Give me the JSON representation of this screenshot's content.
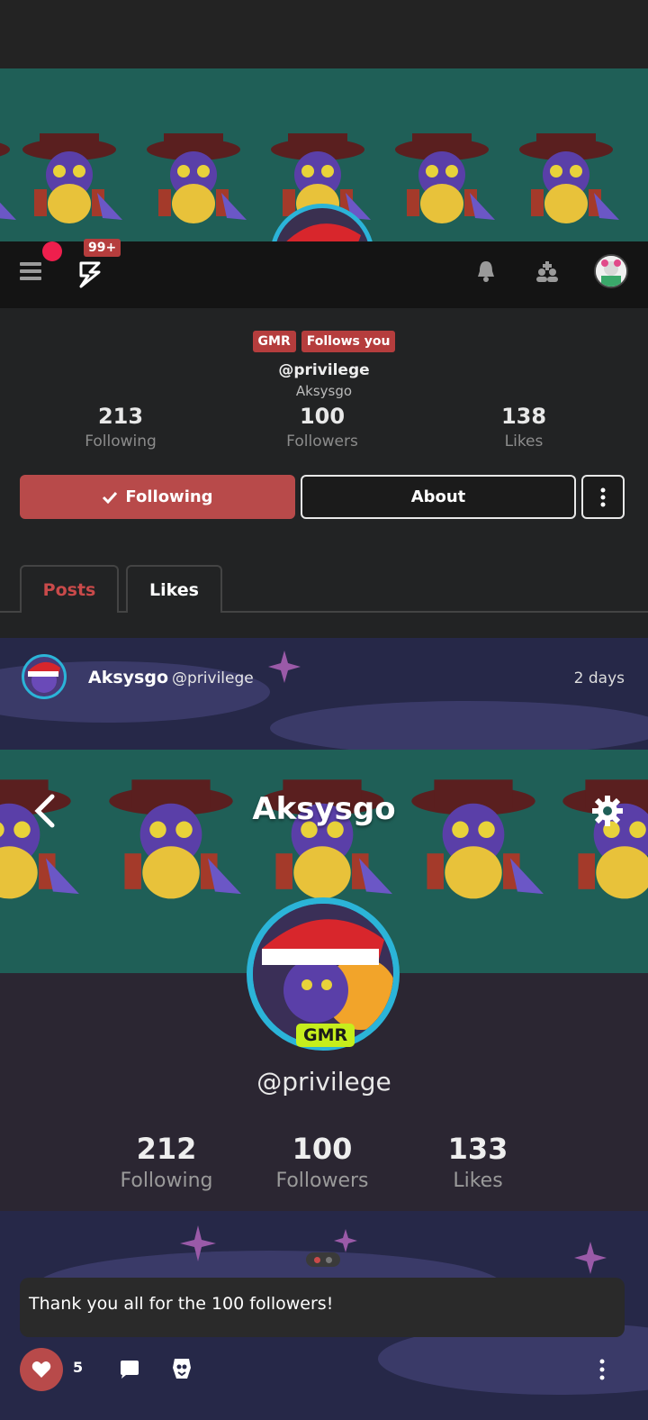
{
  "nav": {
    "notification_badge": "99+",
    "icons": [
      "menu-icon",
      "app-logo-icon",
      "bell-icon",
      "people-icon",
      "user-avatar"
    ]
  },
  "profile": {
    "tags": [
      "GMR",
      "Follows you"
    ],
    "handle": "@privilege",
    "display_name": "Aksysgo",
    "stats": [
      {
        "value": "213",
        "label": "Following"
      },
      {
        "value": "100",
        "label": "Followers"
      },
      {
        "value": "138",
        "label": "Likes"
      }
    ],
    "following_button": "Following",
    "about_button": "About"
  },
  "tabs": {
    "posts": "Posts",
    "likes": "Likes"
  },
  "post": {
    "author": "Aksysgo",
    "author_handle": "@privilege",
    "time": "2 days",
    "embed": {
      "title": "Aksysgo",
      "badge": "GMR",
      "handle": "@privilege",
      "stats": [
        {
          "value": "212",
          "label": "Following"
        },
        {
          "value": "100",
          "label": "Followers"
        },
        {
          "value": "133",
          "label": "Likes"
        }
      ]
    },
    "caption": "Thank you all for the 100 followers!",
    "like_count": "5"
  },
  "colors": {
    "accent": "#b84a4a",
    "banner": "#1f5f57",
    "avatar_ring": "#2bb4d8",
    "gmr_badge": "#c6ee1c",
    "notification_dot": "#ee1f4d"
  }
}
